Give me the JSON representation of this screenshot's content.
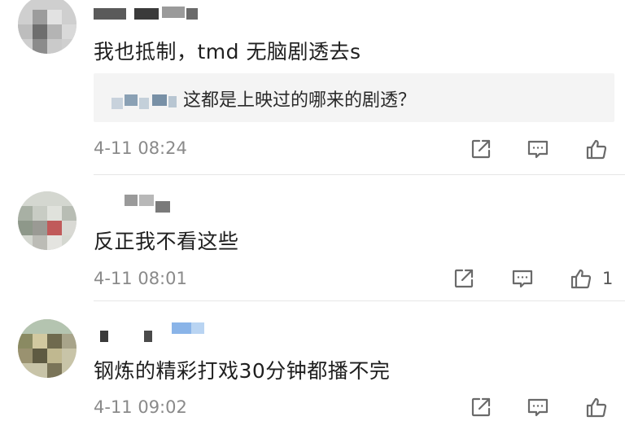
{
  "comments": [
    {
      "content": "我也抵制，tmd 无脑剧透去s",
      "reply": {
        "text": "这都是上映过的哪来的剧透？"
      },
      "time": "4-11 08:24",
      "likes": ""
    },
    {
      "content": "反正我不看这些",
      "time": "4-11 08:01",
      "likes": "1"
    },
    {
      "content": "钢炼的精彩打戏30分钟都播不完",
      "time": "4-11 09:02",
      "likes": ""
    }
  ],
  "icons": {
    "share": "share-icon",
    "comment": "comment-icon",
    "like": "thumbs-up-icon"
  },
  "colors": {
    "text": "#1f1f1f",
    "time": "#8a8a8a",
    "icon": "#6a6a6a",
    "quote_bg": "#f4f4f4"
  }
}
